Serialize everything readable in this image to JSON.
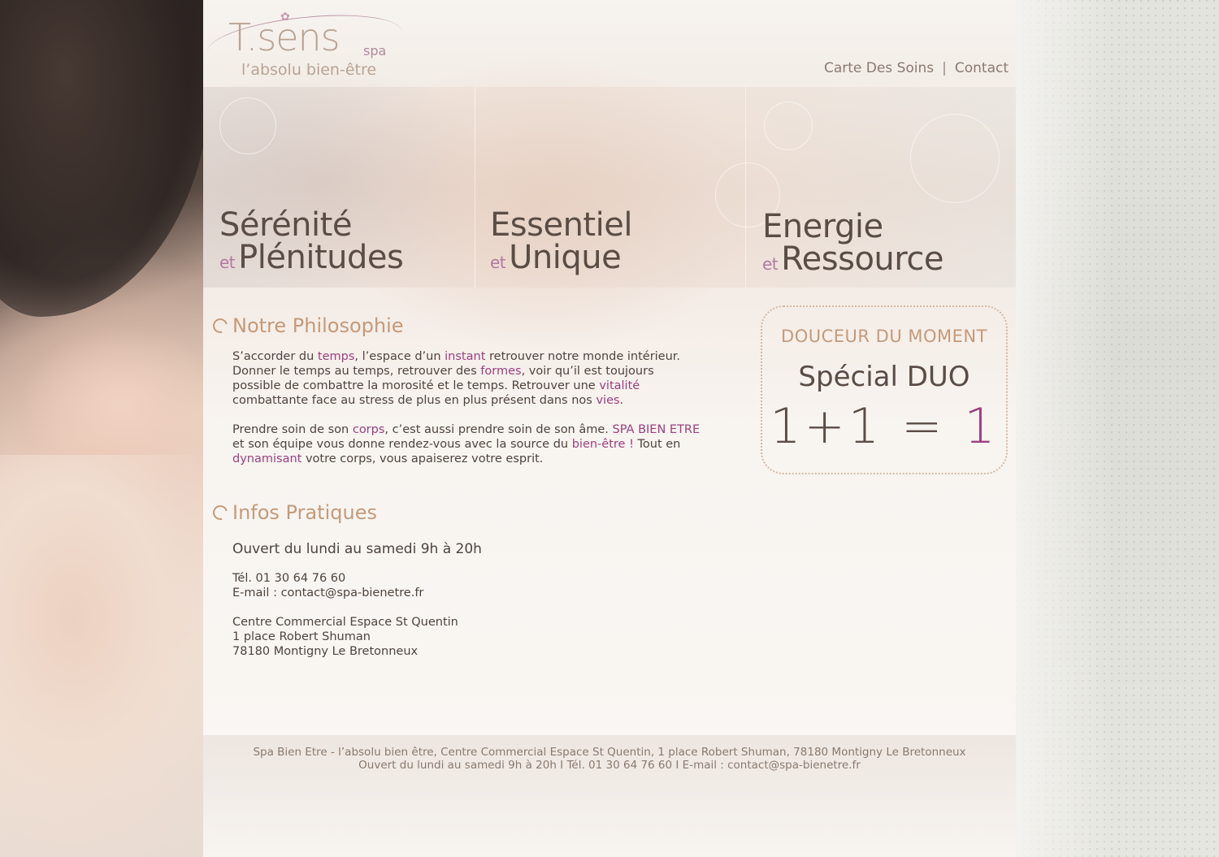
{
  "logo": {
    "brand": "T.sens",
    "spa": "spa",
    "tagline": "l’absolu bien-être"
  },
  "nav": {
    "items": [
      "Carte Des Soins",
      "Contact"
    ],
    "separator": "|"
  },
  "banners": [
    {
      "line1": "Sérénité",
      "et": "et",
      "line2": "Plénitudes"
    },
    {
      "line1": "Essentiel",
      "et": "et",
      "line2": "Unique"
    },
    {
      "line1": "Energie",
      "et": "et",
      "line2": "Ressource"
    }
  ],
  "philosophy": {
    "title": "Notre Philosophie",
    "p1": {
      "a": "S’accorder du ",
      "temps": "temps",
      "b": ",  l’espace d’un ",
      "instant": "instant",
      "c": " retrouver notre monde intérieur. Donner le temps au temps, retrouver des ",
      "formes": "formes",
      "d": ", voir qu’il est toujours possible de combattre la morosité et le temps. Retrouver une ",
      "vitalite": "vitalité",
      "e": " combattante face au stress de plus en plus présent dans nos ",
      "vies": "vies",
      "f": "."
    },
    "p2": {
      "a": "Prendre soin de son ",
      "corps": "corps",
      "b": ", c’est aussi prendre soin de son âme. ",
      "spa": "SPA BIEN ETRE",
      "c": " et son équipe vous donne rendez-vous avec la source du ",
      "bienetre": "bien-être !",
      "d": " Tout en ",
      "dynamisant": "dynamisant",
      "e": " votre corps, vous apaiserez votre esprit."
    }
  },
  "infos": {
    "title": "Infos Pratiques",
    "hours": "Ouvert du lundi au samedi 9h à 20h",
    "tel": "Tél. 01 30 64 76 60",
    "email": "E-mail : contact@spa-bienetre.fr",
    "address1": "Centre Commercial Espace St Quentin",
    "address2": "1 place Robert Shuman",
    "address3": "78180 Montigny Le Bretonneux"
  },
  "promo": {
    "title": "DOUCEUR DU MOMENT",
    "subtitle": "Spécial DUO",
    "equation": "1+1 =",
    "result": "1"
  },
  "footer": {
    "line1": "Spa Bien Etre - l’absolu bien être, Centre Commercial Espace St Quentin, 1 place Robert Shuman, 78180 Montigny Le Bretonneux",
    "line2": "Ouvert du lundi au samedi 9h à 20h  I  Tél. 01 30 64 76 60  I  E-mail : contact@spa-bienetre.fr"
  },
  "colors": {
    "accent_purple": "#9a3f7f",
    "accent_tan": "#c49a7a",
    "text": "#4f443e"
  }
}
